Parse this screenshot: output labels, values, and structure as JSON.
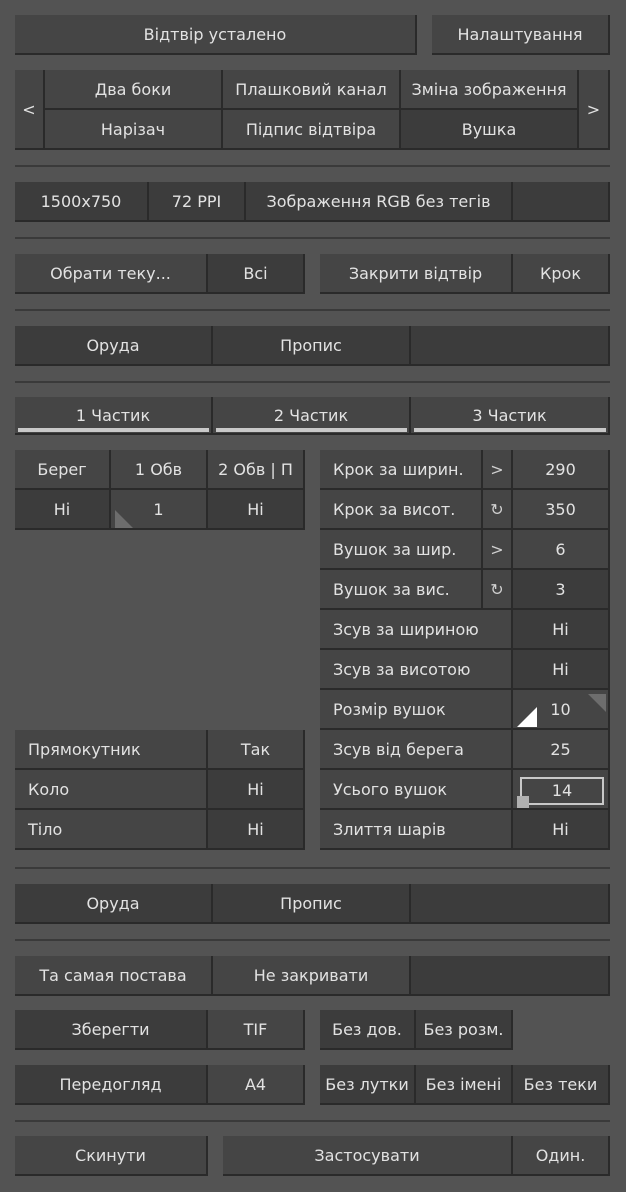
{
  "top": {
    "status": "Відтвір усталено",
    "settings": "Налаштування"
  },
  "tabs": {
    "prev": "<",
    "next": ">",
    "row1": [
      "Два боки",
      "Плашковий канал",
      "Зміна зображення"
    ],
    "row2": [
      "Нарізач",
      "Підпис відтвіра",
      "Вушка"
    ],
    "active": "Вушка"
  },
  "info": {
    "size": "1500x750",
    "ppi": "72 PPI",
    "mode": "Зображення RGB без тегів"
  },
  "folder": {
    "choose": "Обрати теку...",
    "all": "Всі",
    "close": "Закрити відтвір",
    "step": "Крок"
  },
  "panel1": {
    "tools": "Оруда",
    "script": "Пропис"
  },
  "parts": [
    "1 Частик",
    "2 Частик",
    "3 Частик"
  ],
  "left_grid": {
    "headers": [
      "Берег",
      "1 Обв",
      "2 Обв | П"
    ],
    "values": [
      "Ні",
      "1",
      "Ні"
    ]
  },
  "shapes": [
    {
      "label": "Прямокутник",
      "value": "Так"
    },
    {
      "label": "Коло",
      "value": "Ні"
    },
    {
      "label": "Тіло",
      "value": "Ні"
    }
  ],
  "params": [
    {
      "label": "Крок за ширин.",
      "icon": ">",
      "value": "290"
    },
    {
      "label": "Крок за висот.",
      "icon": "↻",
      "value": "350"
    },
    {
      "label": "Вушок за шир.",
      "icon": ">",
      "value": "6"
    },
    {
      "label": "Вушок за вис.",
      "icon": "↻",
      "value": "3"
    },
    {
      "label": "Зсув за шириною",
      "value": "Ні"
    },
    {
      "label": "Зсув за висотою",
      "value": "Ні"
    },
    {
      "label": "Розмір вушок",
      "value": "10"
    },
    {
      "label": "Зсув від берега",
      "value": "25"
    },
    {
      "label": "Усього вушок",
      "value": "14"
    },
    {
      "label": "Злиття шарів",
      "value": "Ні"
    }
  ],
  "panel2": {
    "tools": "Оруда",
    "script": "Пропис"
  },
  "options": {
    "same_pose": "Та самая постава",
    "no_close": "Не закривати"
  },
  "save": {
    "label": "Зберегти",
    "format": "TIF",
    "no_dov": "Без дов.",
    "no_rozm": "Без розм."
  },
  "preview": {
    "label": "Передогляд",
    "format": "A4",
    "no_lutky": "Без лутки",
    "no_name": "Без імені",
    "no_folder": "Без теки"
  },
  "bottom": {
    "reset": "Скинути",
    "apply": "Застосувати",
    "one": "Один."
  }
}
